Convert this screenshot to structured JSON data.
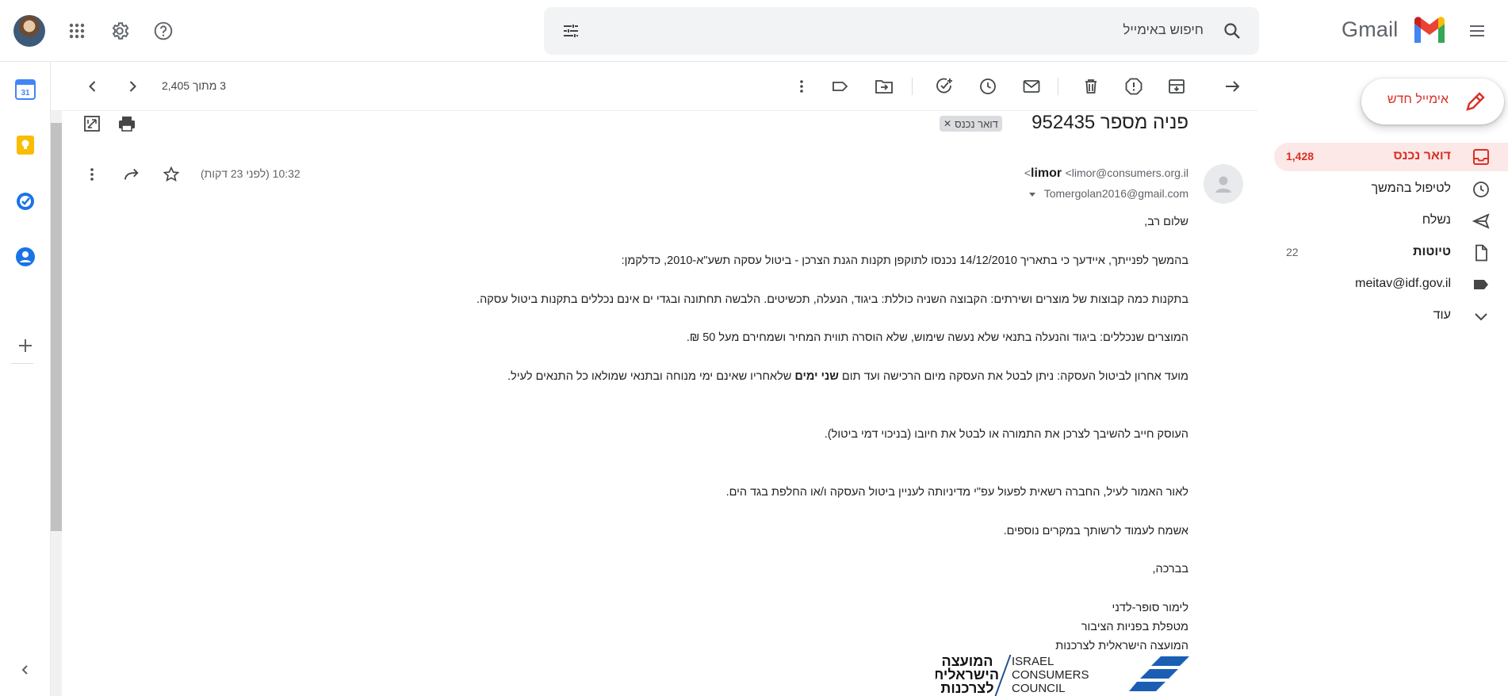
{
  "app": {
    "name": "Gmail"
  },
  "search": {
    "placeholder": "חיפוש באימייל"
  },
  "toolbar": {
    "pager": "3 מתוך 2,405"
  },
  "sidebar": {
    "compose_label": "אימייל חדש",
    "items": [
      {
        "label": "דואר נכנס",
        "count": "1,428",
        "icon": "inbox-icon",
        "active": true
      },
      {
        "label": "לטיפול בהמשך",
        "count": "",
        "icon": "clock-icon"
      },
      {
        "label": "נשלח",
        "count": "",
        "icon": "send-icon"
      },
      {
        "label": "טיוטות",
        "count": "22",
        "icon": "file-icon"
      },
      {
        "label": "meitav@idf.gov.il",
        "count": "",
        "icon": "label-icon"
      },
      {
        "label": "עוד",
        "count": "",
        "icon": "chevron-down-icon"
      }
    ]
  },
  "email": {
    "subject": "פניה מספר 952435",
    "label_chip": "דואר נכנס",
    "sender_name": "limor",
    "sender_email": "<limor@consumers.org.il>",
    "to": "Tomergolan2016@gmail.com",
    "time": "10:32 (לפני 23 דקות)",
    "body": {
      "greeting": "שלום רב,",
      "p1": "בהמשך לפנייתך, איידעך כי בתאריך 14/12/2010 נכנסו לתוקפן תקנות הגנת הצרכן - ביטול עסקה תשע\"א-2010, כדלקמן:",
      "p2": "בתקנות כמה קבוצות של מוצרים ושירתים: הקבוצה השניה כוללת: ביגוד, הנעלה, תכשיטים. הלבשה תחתונה ובגדי ים אינם נכללים בתקנות ביטול עסקה.",
      "p3": "המוצרים שנכללים: ביגוד והנעלה בתנאי שלא נעשה שימוש, שלא הוסרה תווית המחיר ושמחירם מעל 50 ₪.",
      "p4_before": "מועד אחרון לביטול העסקה: ניתן לבטל את העסקה מיום הרכישה ועד תום ",
      "p4_bold": "שני ימים",
      "p4_after": " שלאחריו שאינם ימי מנוחה ובתנאי שמולאו כל התנאים לעיל.",
      "p5": "העוסק חייב להשיבך לצרכן את התמורה או לבטל את חיובו (בניכוי דמי ביטול).",
      "p6": "לאור האמור לעיל, החברה רשאית לפעול עפ\"י מדיניותה לעניין ביטול העסקה ו/או החלפת בגד הים.",
      "p7": "אשמח לעמוד לרשותך במקרים נוספים.",
      "closing": "בברכה,",
      "sig_name": "לימור סופר-לדני",
      "sig_role": "מטפלת בפניות הציבור",
      "sig_org": "המועצה הישראלית לצרכנות"
    },
    "logo": {
      "heb_line1": "המועצה",
      "heb_line2": "הישראלית",
      "heb_line3": "לצרכנות",
      "en_line1": "ISRAEL",
      "en_line2": "CONSUMERS",
      "en_line3": "COUNCIL"
    }
  },
  "colors": {
    "accent_red": "#d93025",
    "inbox_bg": "#fce8e6",
    "search_bg": "#f1f3f4"
  }
}
